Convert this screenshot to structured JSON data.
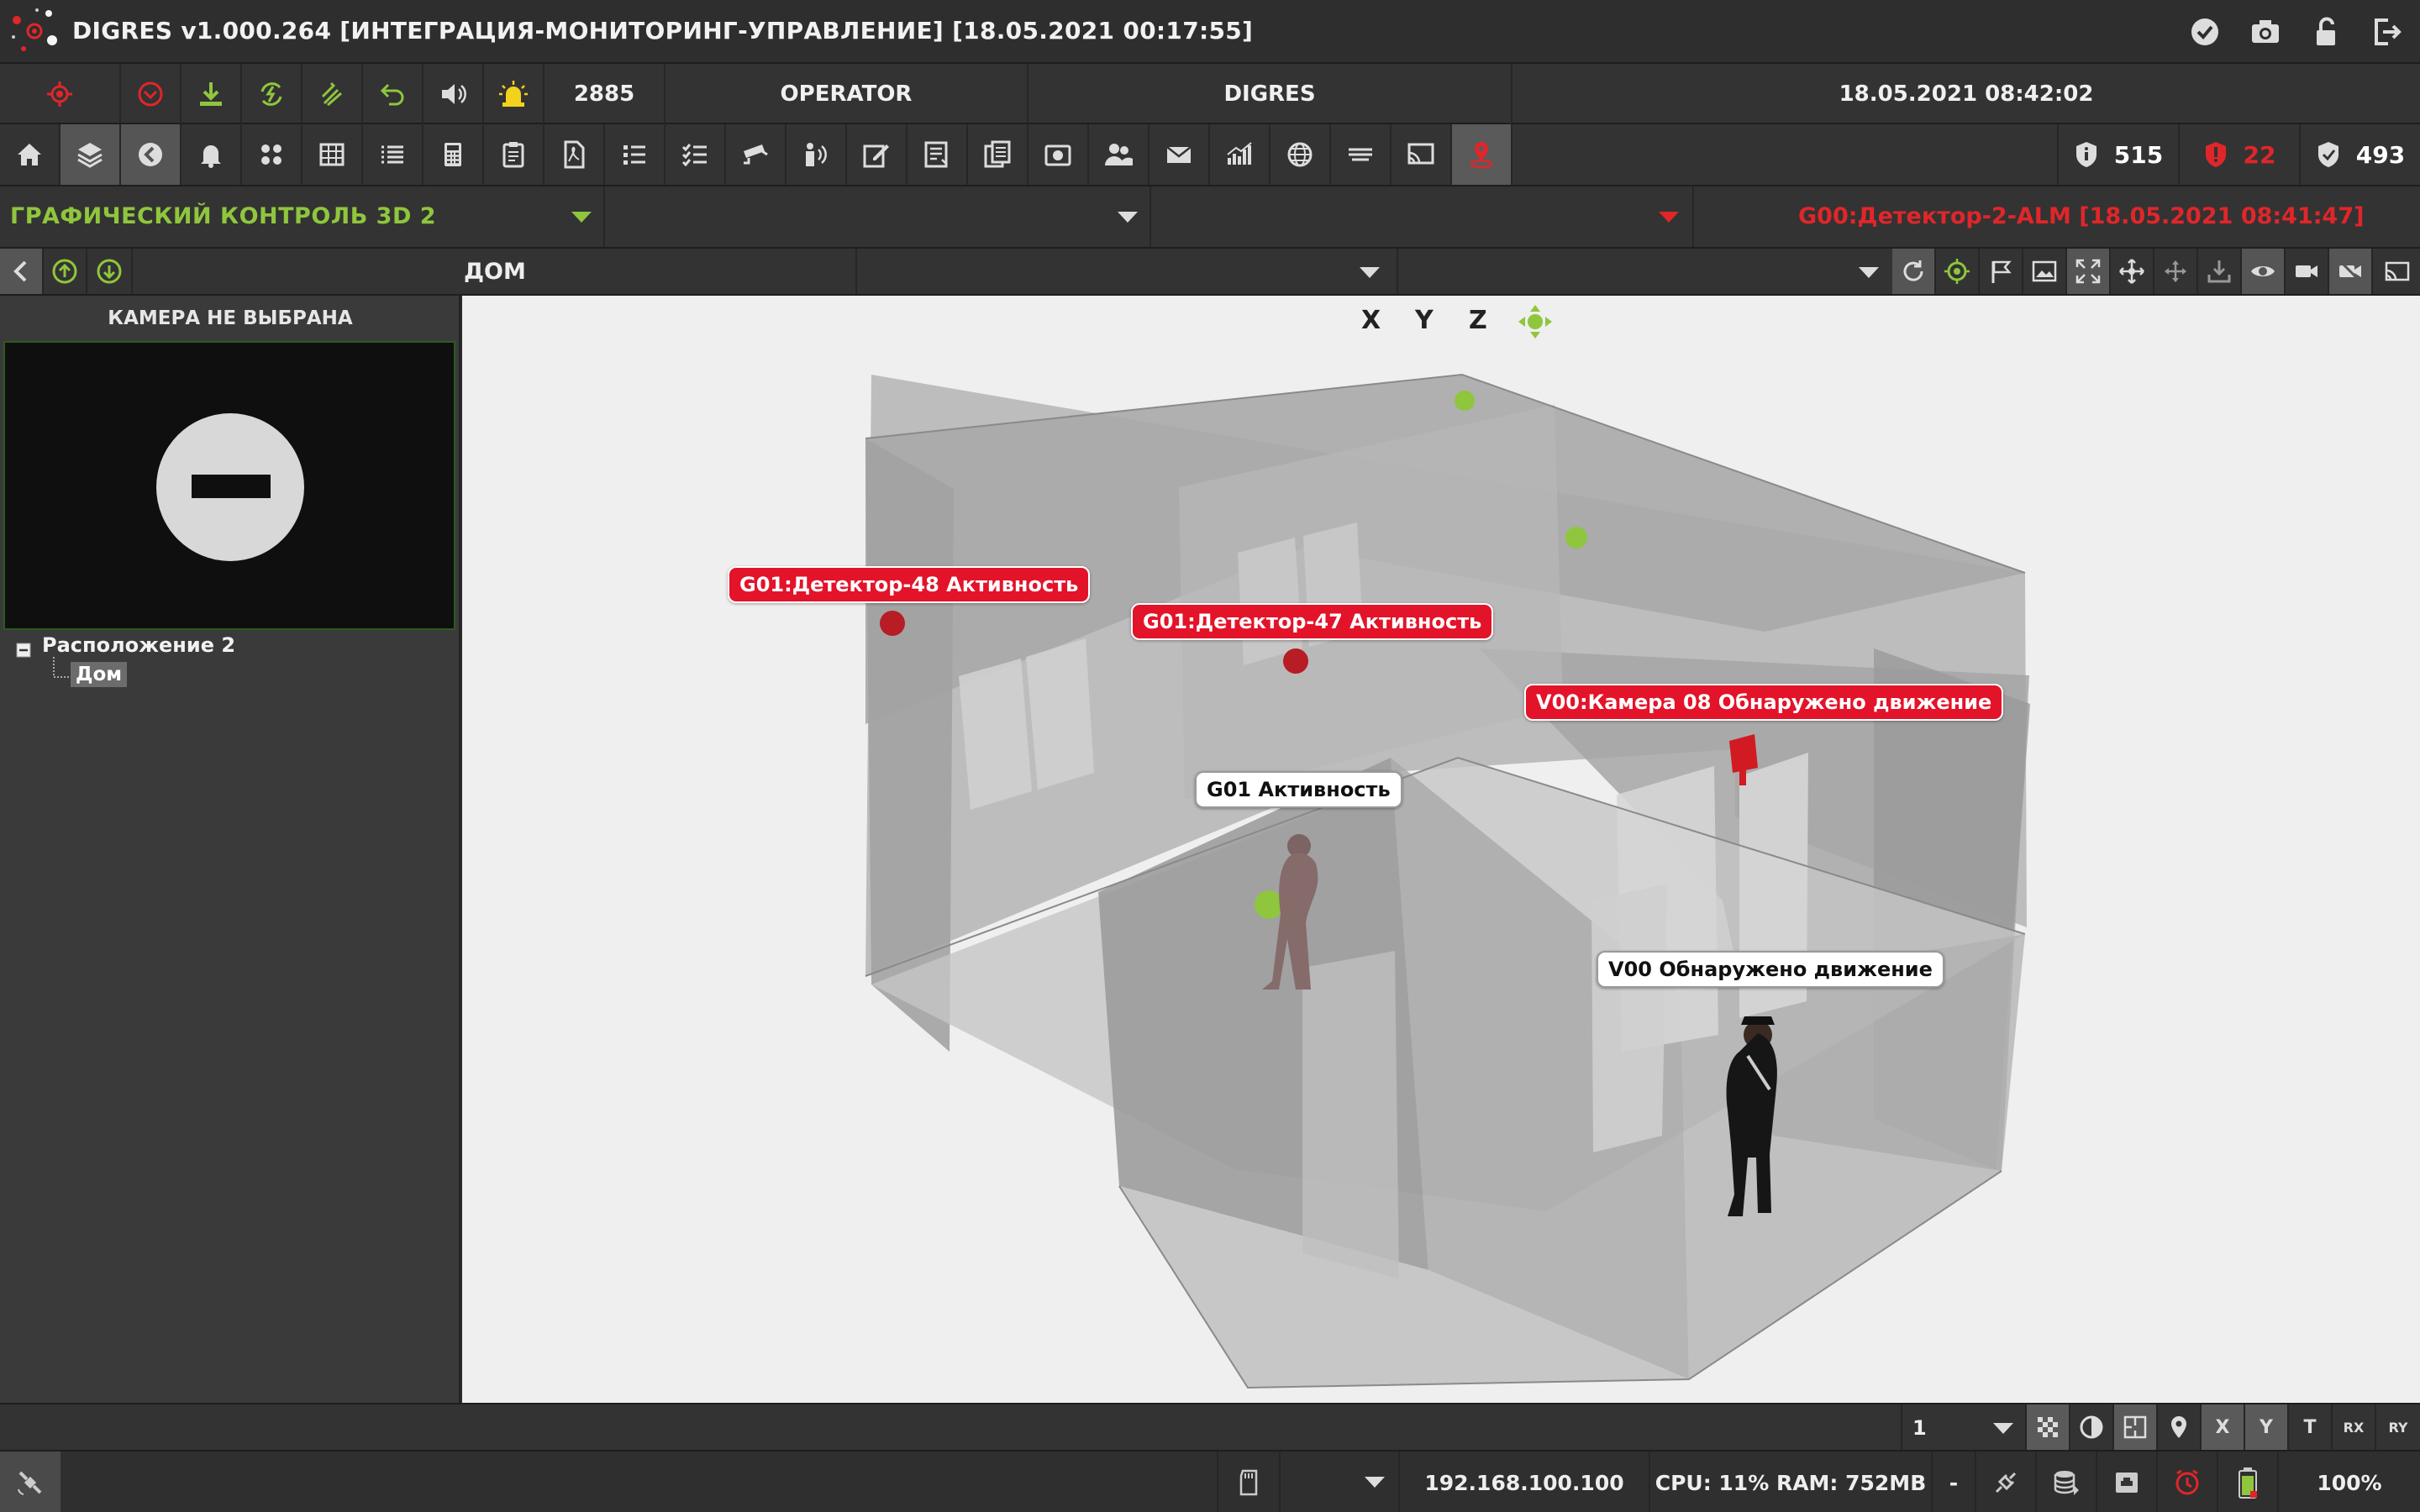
{
  "window": {
    "title": "DIGRES v1.000.264 [ИНТЕГРАЦИЯ-МОНИТОРИНГ-УПРАВЛЕНИЕ] [18.05.2021 00:17:55]"
  },
  "header": {
    "counter": "2885",
    "role": "OPERATOR",
    "system": "DIGRES",
    "datetime": "18.05.2021 08:42:02"
  },
  "toolbar": {
    "icons": [
      "home-icon",
      "layers-icon",
      "back-circle-icon",
      "bell-icon",
      "grid-dots-icon",
      "table-icon",
      "list-icon",
      "calculator-icon",
      "clipboard-icon",
      "pdf-icon",
      "bullet-list-icon",
      "checklist-icon",
      "cctv-icon",
      "intercom-icon",
      "edit-icon",
      "report-icon",
      "documents-icon",
      "camera-album-icon",
      "users-icon",
      "mail-icon",
      "chart-icon",
      "globe-icon",
      "divider-lines-icon",
      "cast-icon",
      "map-pin-icon"
    ]
  },
  "stats": {
    "total": "515",
    "alarms": "22",
    "ok": "493",
    "colors": {
      "total": "#ffffff",
      "alarms": "#e0262a",
      "ok": "#ffffff"
    }
  },
  "view": {
    "name": "ГРАФИЧЕСКИЙ КОНТРОЛЬ 3D 2",
    "last_alarm": "G00:Детектор-2-ALM [18.05.2021 08:41:47]"
  },
  "location": {
    "current": "ДОМ"
  },
  "camera": {
    "status": "КАМЕРА НЕ ВЫБРАНА"
  },
  "tree": {
    "root": "Расположение 2",
    "child": "Дом"
  },
  "scene": {
    "axes": [
      "X",
      "Y",
      "Z"
    ],
    "labels": {
      "det48": "G01:Детектор-48 Активность",
      "det47": "G01:Детектор-47 Активность",
      "cam08": "V00:Камера 08 Обнаружено движение",
      "g01": "G01 Активность",
      "v00": "V00 Обнаружено движение"
    }
  },
  "bottom": {
    "page": "1",
    "buttons": [
      "X",
      "Y",
      "T",
      "RX",
      "RY"
    ]
  },
  "status": {
    "dash": "-",
    "ip": "192.168.100.100",
    "resources": "CPU: 11% RAM: 752MB",
    "zoom": "100%"
  }
}
